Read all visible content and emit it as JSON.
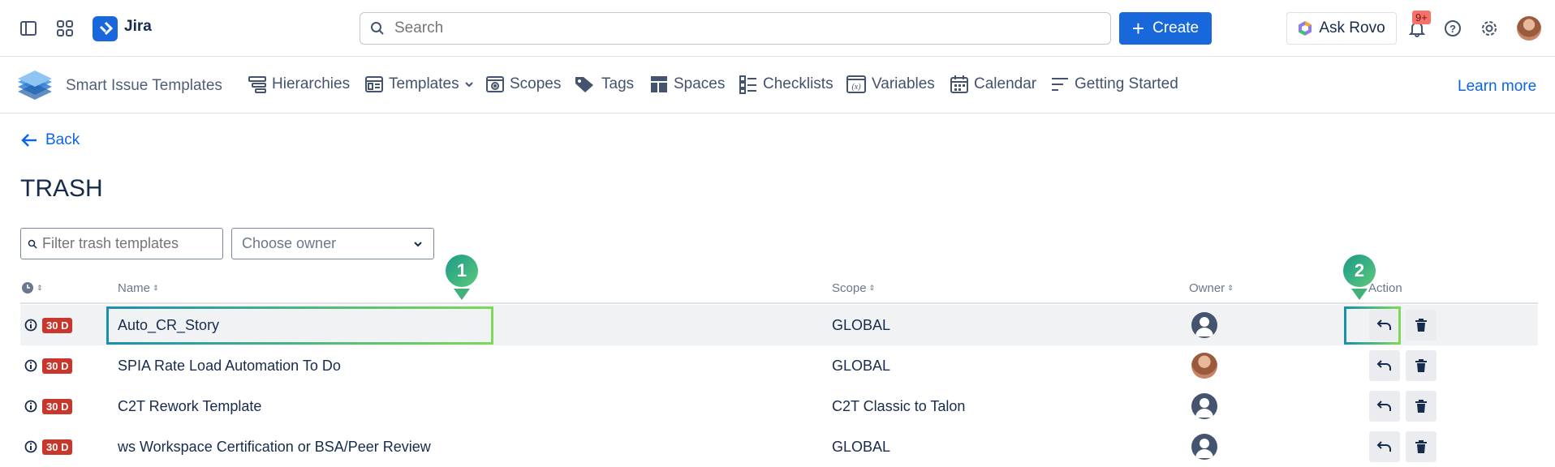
{
  "topbar": {
    "product_name": "Jira",
    "search_placeholder": "Search",
    "create_label": "Create",
    "rovo_label": "Ask Rovo",
    "notification_badge": "9+"
  },
  "appnav": {
    "title": "Smart Issue Templates",
    "items": [
      {
        "label": "Hierarchies",
        "icon": "hierarchy-icon"
      },
      {
        "label": "Templates",
        "icon": "template-icon"
      },
      {
        "label": "Scopes",
        "icon": "scope-icon"
      },
      {
        "label": "Tags",
        "icon": "tag-icon"
      },
      {
        "label": "Spaces",
        "icon": "space-icon"
      },
      {
        "label": "Checklists",
        "icon": "checklist-icon"
      },
      {
        "label": "Variables",
        "icon": "variable-icon"
      },
      {
        "label": "Calendar",
        "icon": "calendar-icon"
      },
      {
        "label": "Getting Started",
        "icon": "lines-icon"
      }
    ],
    "learn_more": "Learn more"
  },
  "page": {
    "back_label": "Back",
    "title": "TRASH",
    "filter_placeholder": "Filter trash templates",
    "owner_placeholder": "Choose owner"
  },
  "table": {
    "headers": {
      "name": "Name",
      "scope": "Scope",
      "owner": "Owner",
      "action": "Action"
    },
    "rows": [
      {
        "days": "30 D",
        "name": "Auto_CR_Story",
        "scope": "GLOBAL"
      },
      {
        "days": "30 D",
        "name": "SPIA Rate Load Automation To Do",
        "scope": "GLOBAL"
      },
      {
        "days": "30 D",
        "name": "C2T Rework Template",
        "scope": "C2T Classic to Talon"
      },
      {
        "days": "30 D",
        "name": "ws Workspace Certification or BSA/Peer Review",
        "scope": "GLOBAL"
      }
    ]
  },
  "callouts": {
    "first": "1",
    "second": "2"
  },
  "colors": {
    "primary": "#1868db",
    "danger": "#c9372c",
    "link": "#0c66e4"
  }
}
